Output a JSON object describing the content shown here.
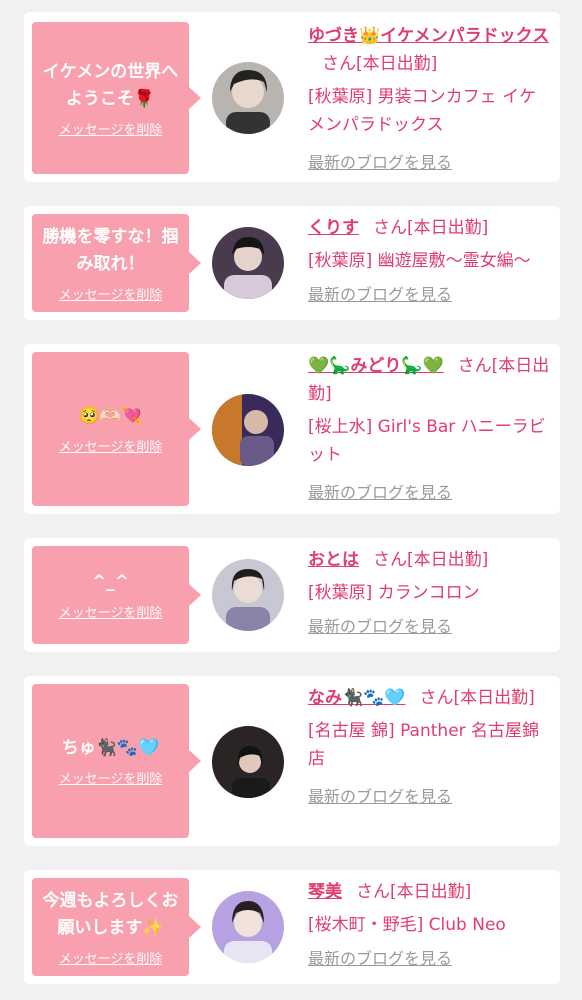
{
  "delete_label": "メッセージを削除",
  "blog_label": "最新のブログを見る",
  "colors": {
    "bubble": "#f9a0ae",
    "accent": "#e03d6e",
    "muted": "#9a9a9a",
    "card": "#ffffff",
    "page": "#f1f1f1"
  },
  "entries": [
    {
      "message": "イケメンの世界へようこそ🌹",
      "name": "ゆづき👑イケメンパラドックス",
      "suffix": "さん[本日出勤]",
      "shop": "[秋葉原] 男装コンカフェ イケメンパラドックス"
    },
    {
      "message": "勝機を零すな！掴み取れ！",
      "name": "くりす",
      "suffix": "さん[本日出勤]",
      "shop": "[秋葉原] 幽遊屋敷〜霊女編〜"
    },
    {
      "message": "🥺🫶🏻💘",
      "name": "💚🦕みどり🦕💚",
      "suffix": "さん[本日出勤]",
      "shop": "[桜上水] Girl's Bar ハニーラビット"
    },
    {
      "message": "^_^",
      "name": "おとは",
      "suffix": "さん[本日出勤]",
      "shop": "[秋葉原] カランコロン"
    },
    {
      "message": "ちゅ🐈‍⬛🐾🩵",
      "name": "なみ🐈‍⬛🐾🩵",
      "suffix": "さん[本日出勤]",
      "shop": "[名古屋 錦] Panther 名古屋錦店"
    },
    {
      "message": "今週もよろしくお願いします✨",
      "name": "琴美",
      "suffix": "さん[本日出勤]",
      "shop": "[桜木町・野毛] Club Neo"
    }
  ]
}
